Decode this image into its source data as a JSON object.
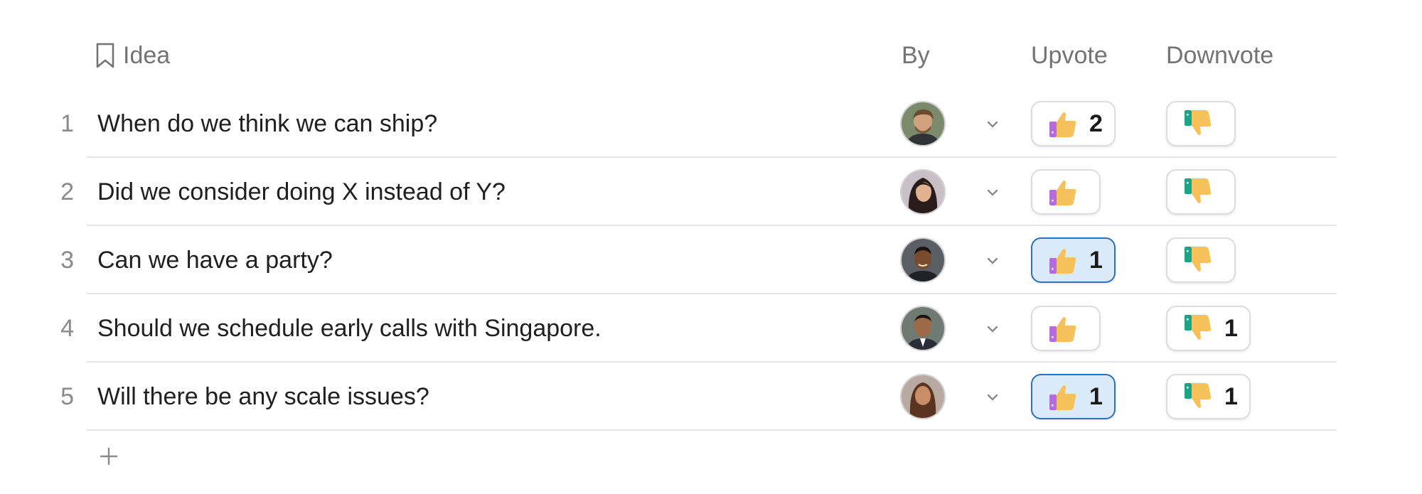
{
  "columns": {
    "idea": "Idea",
    "by": "By",
    "upvote": "Upvote",
    "downvote": "Downvote"
  },
  "icons": {
    "header_idea": "bookmark-icon",
    "upvote": "thumbs-up-icon",
    "downvote": "thumbs-down-icon",
    "expand": "chevron-down-icon",
    "add": "plus-icon"
  },
  "colors": {
    "active_vote_bg": "#dbeafb",
    "active_vote_border": "#2f6fc0",
    "thumb_yellow": "#f6c05a",
    "thumbs_up_cuff": "#b46be0",
    "thumbs_down_cuff": "#1aa58a"
  },
  "rows": [
    {
      "num": "1",
      "idea": "When do we think we can ship?",
      "upvotes": "2",
      "downvotes": "",
      "upvote_selected": false
    },
    {
      "num": "2",
      "idea": "Did we consider doing X instead of Y?",
      "upvotes": "",
      "downvotes": "",
      "upvote_selected": false
    },
    {
      "num": "3",
      "idea": "Can we have a party?",
      "upvotes": "1",
      "downvotes": "",
      "upvote_selected": true
    },
    {
      "num": "4",
      "idea": "Should we schedule early calls with Singapore.",
      "upvotes": "",
      "downvotes": "1",
      "upvote_selected": false
    },
    {
      "num": "5",
      "idea": "Will there be any scale issues?",
      "upvotes": "1",
      "downvotes": "1",
      "upvote_selected": true
    }
  ]
}
